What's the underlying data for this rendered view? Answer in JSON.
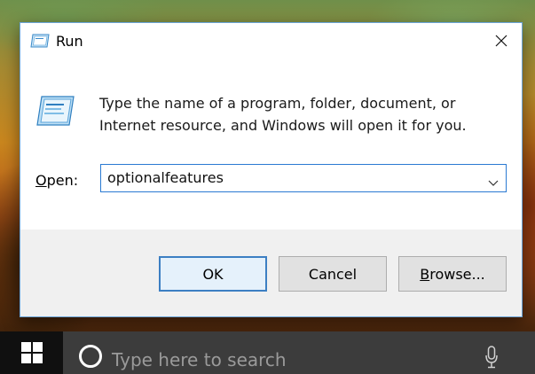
{
  "dialog": {
    "title": "Run",
    "description": "Type the name of a program, folder, document, or Internet resource, and Windows will open it for you.",
    "open_label_accel": "O",
    "open_label_rest": "pen:",
    "input_value": "optionalfeatures",
    "buttons": {
      "ok": "OK",
      "cancel": "Cancel",
      "browse_accel": "B",
      "browse_rest": "rowse..."
    }
  },
  "taskbar": {
    "search_placeholder": "Type here to search"
  },
  "colors": {
    "accent": "#3c7fc3",
    "footer": "#f0f0f0",
    "taskbar": "#101010",
    "searchbox": "#3c3c3c"
  },
  "icons": [
    "run-icon",
    "run-program-icon",
    "close-icon",
    "chevron-down-icon",
    "windows-start-icon",
    "cortana-icon",
    "microphone-icon"
  ]
}
